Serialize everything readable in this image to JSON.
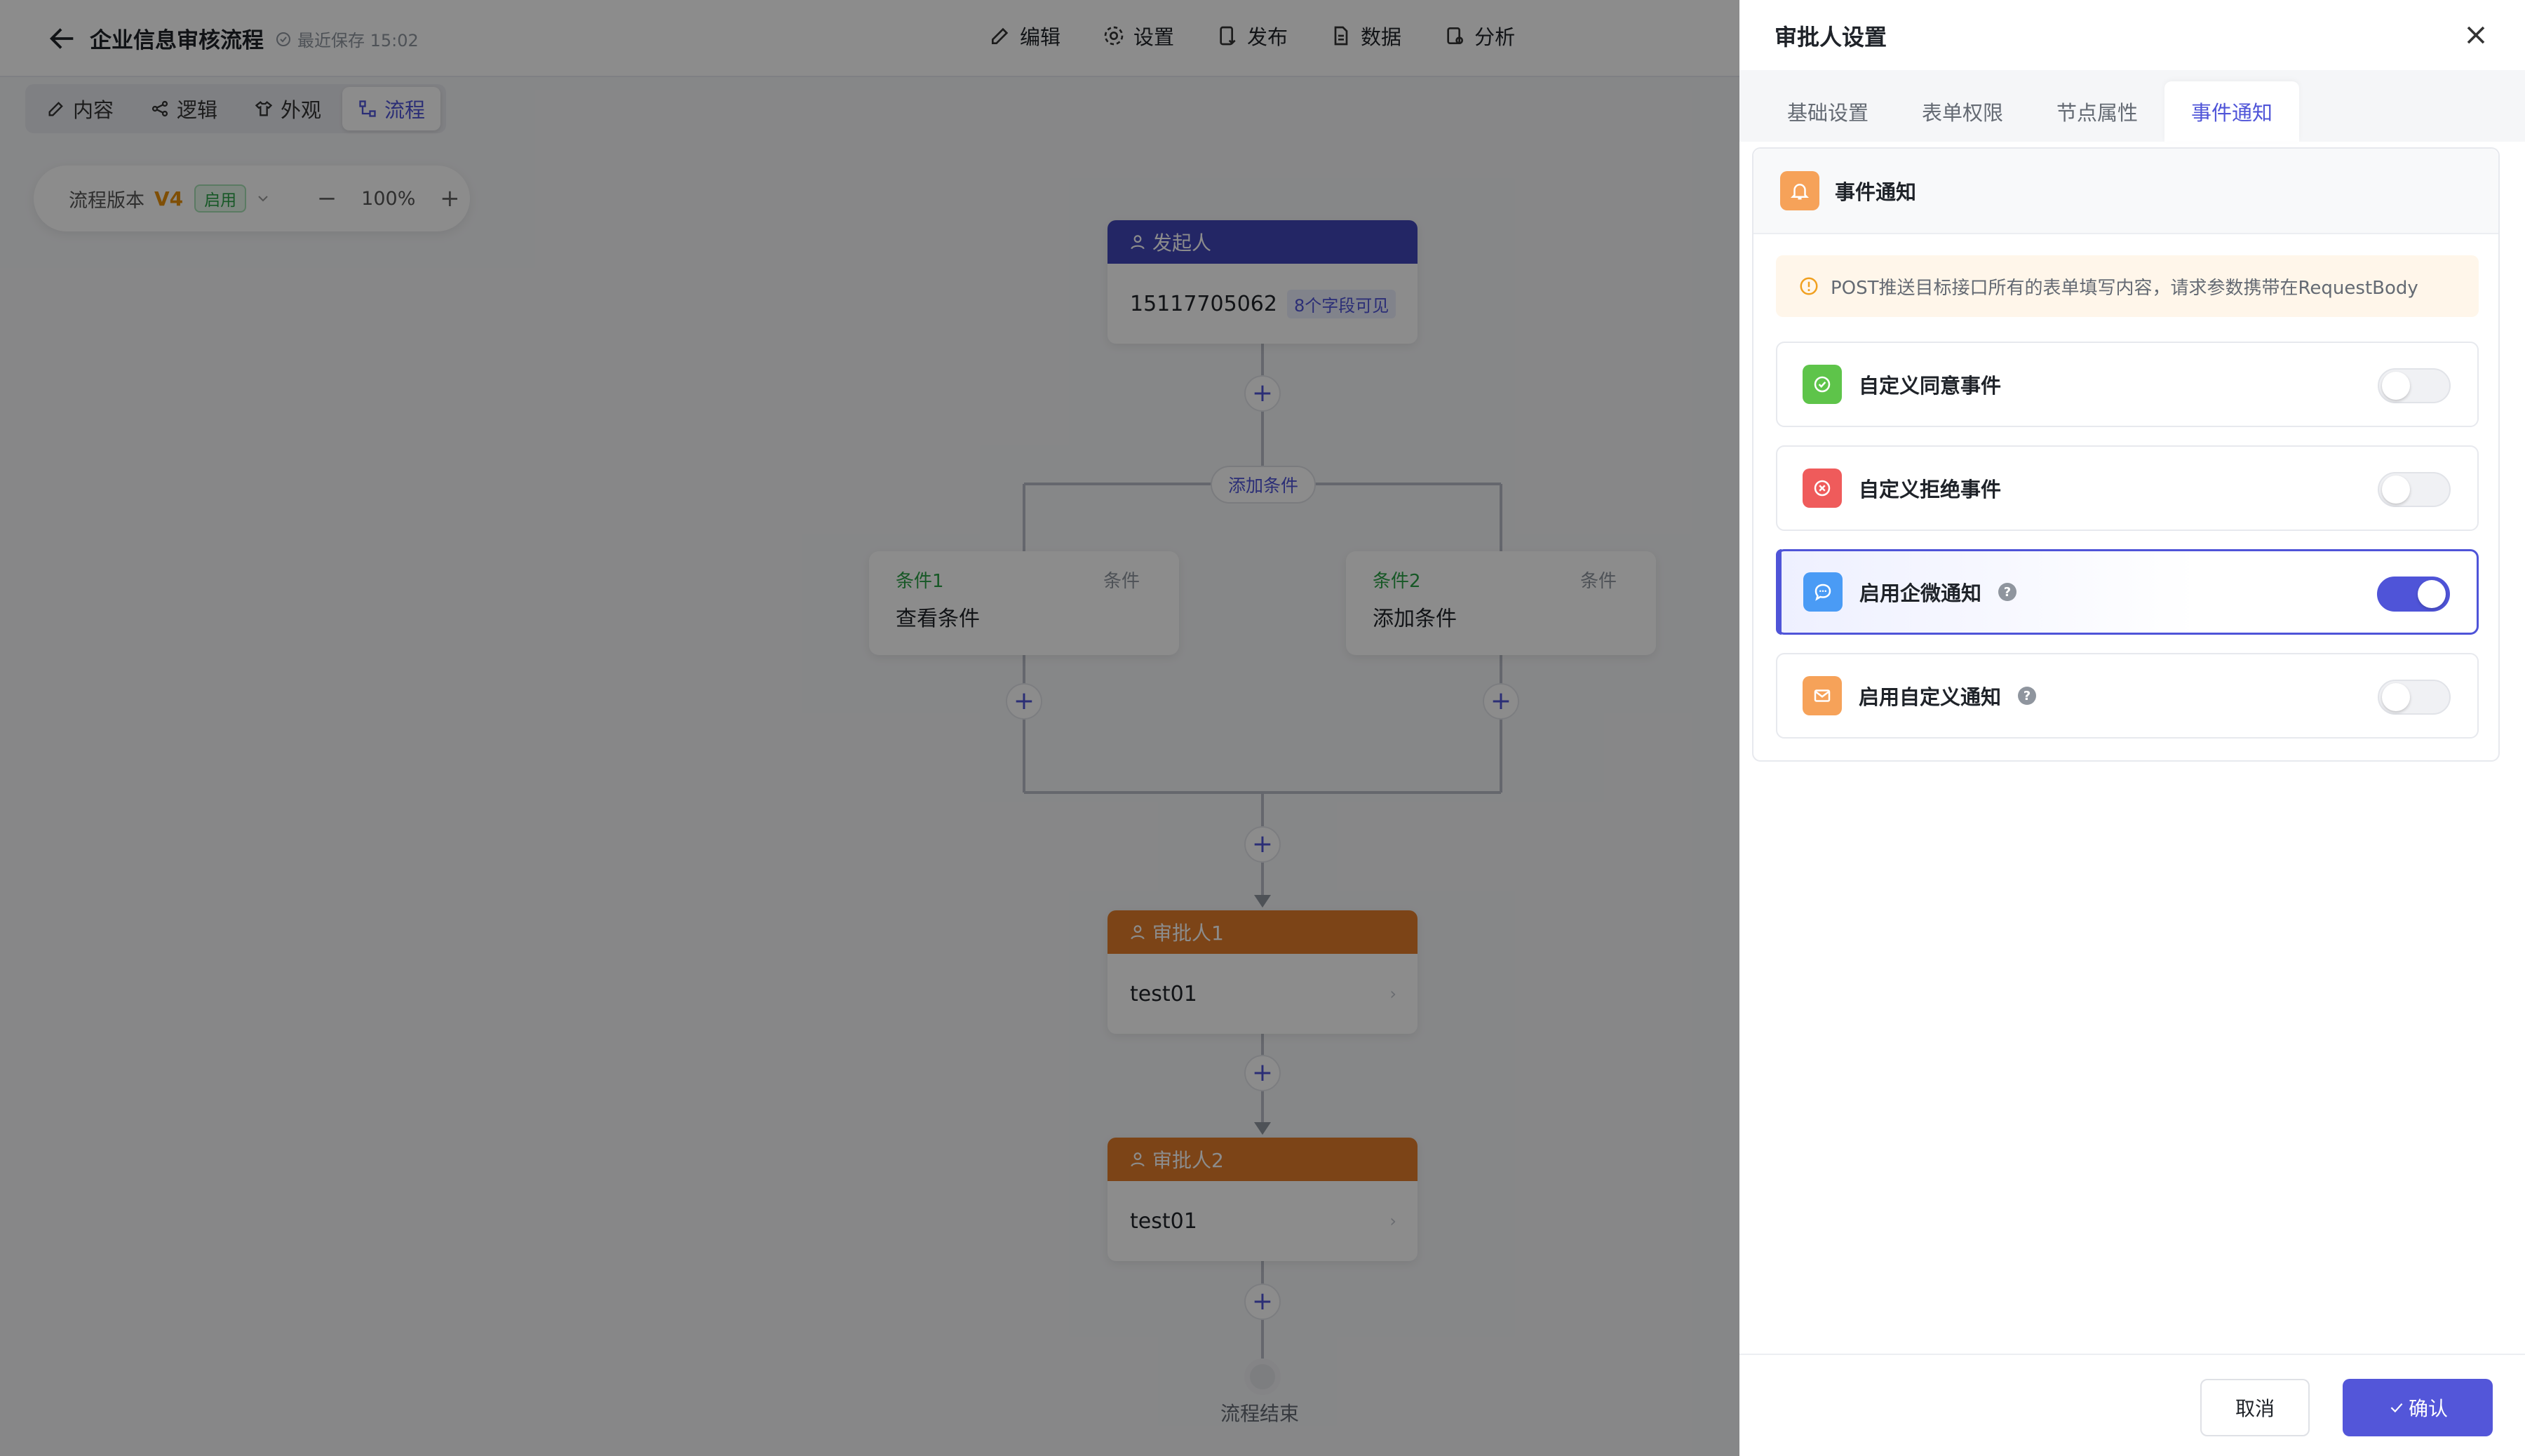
{
  "editor": {
    "title": "企业信息审核流程",
    "save_status": "最近保存 15:02",
    "top_menu": [
      "编辑",
      "设置",
      "发布",
      "数据",
      "分析"
    ],
    "sub_tabs": [
      "内容",
      "逻辑",
      "外观",
      "流程"
    ],
    "active_sub_tab": "流程",
    "version_label": "流程版本",
    "version": "V4",
    "version_status": "启用",
    "zoom_minus": "−",
    "zoom": "100%",
    "zoom_plus": "+",
    "accent_color": "#4f54d8"
  },
  "flow": {
    "start_node": {
      "header": "发起人",
      "value": "15117705062",
      "tag": "8个字段可见",
      "color": "#4145b8"
    },
    "add_condition": "添加条件",
    "conditions": [
      {
        "name": "条件1",
        "type": "条件",
        "value": "查看条件"
      },
      {
        "name": "条件2",
        "type": "条件",
        "value": "添加条件"
      }
    ],
    "approvers": [
      {
        "header": "审批人1",
        "value": "test01",
        "color": "#e27d2a"
      },
      {
        "header": "审批人2",
        "value": "test01",
        "color": "#e27d2a"
      }
    ],
    "end_label": "流程结束"
  },
  "drawer": {
    "title": "审批人设置",
    "tabs": [
      "基础设置",
      "表单权限",
      "节点属性",
      "事件通知"
    ],
    "active_tab": "事件通知",
    "panel_title": "事件通知",
    "notice": "POST推送目标接口所有的表单填写内容，请求参数携带在RequestBody",
    "rows": [
      {
        "label": "自定义同意事件",
        "icon": "check-circle-icon",
        "icon_color": "#5ec44a",
        "enabled": false,
        "help": false
      },
      {
        "label": "自定义拒绝事件",
        "icon": "x-circle-icon",
        "icon_color": "#ef5b5b",
        "enabled": false,
        "help": false
      },
      {
        "label": "启用企微通知",
        "icon": "chat-icon",
        "icon_color": "#4a9bf5",
        "enabled": true,
        "help": true
      },
      {
        "label": "启用自定义通知",
        "icon": "mail-icon",
        "icon_color": "#f6a259",
        "enabled": false,
        "help": true
      }
    ],
    "cancel_label": "取消",
    "confirm_label": "确认"
  }
}
